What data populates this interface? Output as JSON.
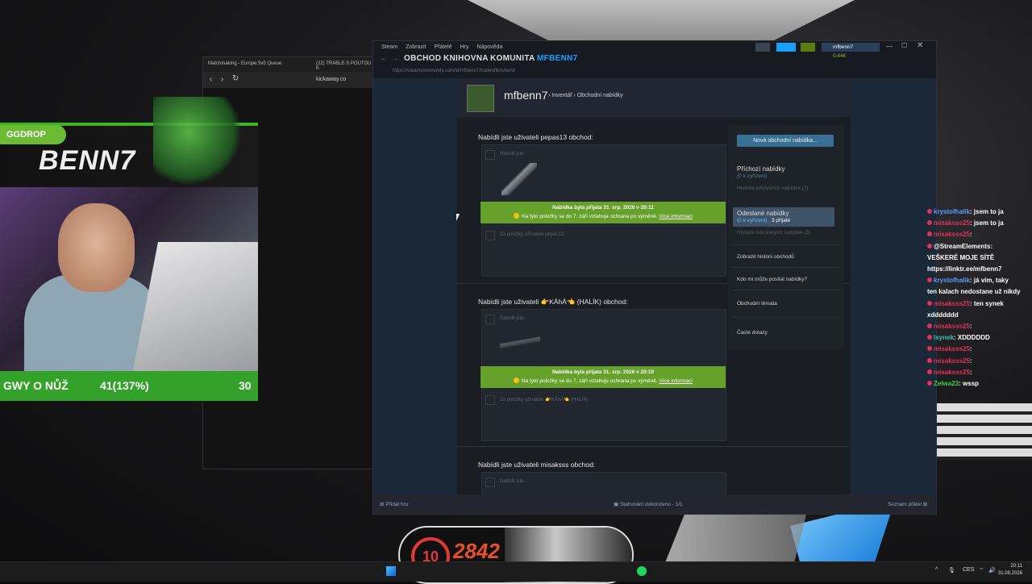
{
  "colors": {
    "steam_accent": "#66c0f4",
    "accepted_green": "#66a12b",
    "overlay_green": "#33a12a",
    "chat_red": "#e0325e",
    "chat_blue": "#5a9bff"
  },
  "overlay": {
    "brand": "GGDROP",
    "streamer": "BENN7",
    "goal_label": "GWY O NŮŽ",
    "goal_progress": "41(137%)",
    "goal_target": "30"
  },
  "browser": {
    "tabs": [
      "Matchmaking - Europe 5v5 Queue",
      "(22) TRABLE S POUTOU K"
    ],
    "address": "kickaway.co"
  },
  "steam": {
    "menu": [
      "Steam",
      "Zobrazit",
      "Přátelé",
      "Hry",
      "Nápověda"
    ],
    "nav": [
      "OBCHOD",
      "KNIHOVNA",
      "KOMUNITA",
      "MFBENN7"
    ],
    "account": "mfbenn7",
    "balance": "0,44€",
    "url": "https://steamcommunity.com/id/mfbenn7/tradeoffers/sent/",
    "profile_name": "mfbenn7",
    "breadcrumb": [
      "Inventář",
      "Obchodní nabídky"
    ],
    "offers": [
      {
        "title": "Nabídli jste uživateli pepas13 obchod:",
        "your_items": "Nabídli jste",
        "accepted": "Nabídka byla přijata 31. srp. 2026 v 20:11",
        "protection": "Na tyto položky se do 7. září vztahuje ochrana po výměně.",
        "more": "Více informací",
        "their_items": "Za položky uživatele pepas13"
      },
      {
        "title": "Nabídli jste uživateli 👉KÁhÁ👈 (HALÍK) obchod:",
        "your_items": "Nabídli jste",
        "accepted": "Nabídka byla přijata 31. srp. 2026 v 20:10",
        "protection": "Na tyto položky se do 7. září vztahuje ochrana po výměně.",
        "more": "Více informací",
        "their_items": "Za položky uživatele 👉KÁhÁ👈 (HALÍK)"
      },
      {
        "title": "Nabídli jste uživateli misaksss obchod:",
        "your_items": "Nabídli jste"
      }
    ],
    "sidebar": {
      "new_offer": "Nová obchodní nabídka...",
      "incoming": "Příchozí nabídky",
      "incoming_sub": "(0 k vyřízení)",
      "incoming_history": "Historie příchozích nabídek (7)",
      "sent": "Odeslané nabídky",
      "sent_pending": "(0 k vyřízení)",
      "sent_accepted": "3 přijaté",
      "sent_history": "Historie odeslaných nabídek (3)",
      "trade_history": "Zobrazit historii obchodů",
      "who_can": "Kdo mi může posílat nabídky?",
      "topics": "Obchodní témata",
      "faq": "Časté dotazy"
    },
    "footer": {
      "add_game": "Přidat hru",
      "downloads": "Stahování dokončeno - 1/1",
      "friends": "Seznam přátel"
    }
  },
  "chat": [
    {
      "user": "krystofhalik",
      "msg": ": jsem to ja",
      "color": "#5a9bff"
    },
    {
      "user": "misaksss25",
      "msg": ": jsem to ja",
      "color": "#e0325e"
    },
    {
      "user": "misaksss25",
      "msg": ":",
      "color": "#e0325e"
    },
    {
      "user": "@StreamElements",
      "msg": ":",
      "color": "#ffffff"
    },
    {
      "user": "",
      "msg": "VEŠKERÉ MOJE SÍTĚ",
      "color": "#ffffff"
    },
    {
      "user": "",
      "msg": "https://linktr.ee/mfbenn7",
      "color": "#ffffff"
    },
    {
      "user": "krystofhalik",
      "msg": ": já vím, taky",
      "color": "#5a9bff"
    },
    {
      "user": "",
      "msg": "ten kalach nedostane už nikdy",
      "color": "#ffffff"
    },
    {
      "user": "misaksss25",
      "msg": ": ten synek",
      "color": "#e0325e"
    },
    {
      "user": "",
      "msg": "xddddddd",
      "color": "#ffffff"
    },
    {
      "user": "misaksss25",
      "msg": ":",
      "color": "#e0325e"
    },
    {
      "user": "lsynek",
      "msg": ": XDDDDDD",
      "color": "#39c5bb"
    },
    {
      "user": "misaksss25",
      "msg": ":",
      "color": "#e0325e"
    },
    {
      "user": "misaksss25",
      "msg": ":",
      "color": "#e0325e"
    },
    {
      "user": "misaksss25",
      "msg": ":",
      "color": "#e0325e"
    },
    {
      "user": "Zelwa23",
      "msg": ": wssp",
      "color": "#3fd14a"
    }
  ],
  "stats": {
    "level": "10",
    "elo": "2842"
  },
  "taskbar": {
    "lang": "CES",
    "time": "20:11",
    "date": "31.08.2026"
  }
}
